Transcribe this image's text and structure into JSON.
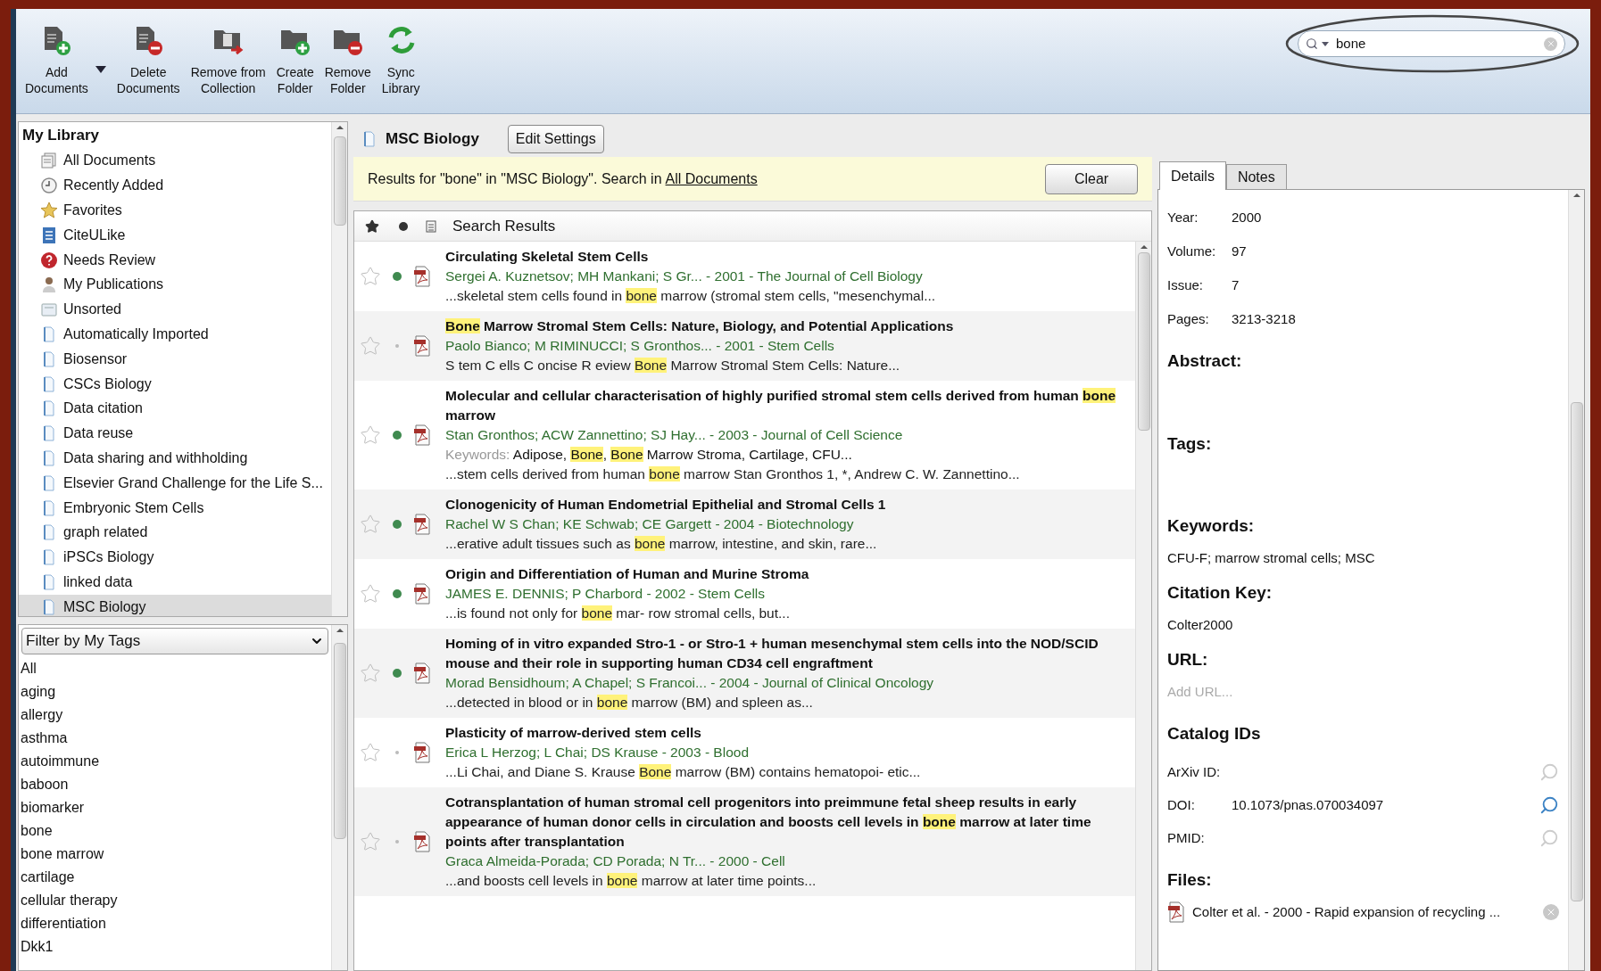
{
  "toolbar": {
    "buttons": [
      {
        "label": "Add Documents",
        "kind": "doc-add",
        "menu": true
      },
      {
        "label": "Delete Documents",
        "kind": "doc-delete",
        "menu": false
      },
      {
        "label": "Remove from Collection",
        "kind": "collection-remove",
        "menu": false
      },
      {
        "label": "Create Folder",
        "kind": "folder-add",
        "menu": false
      },
      {
        "label": "Remove Folder",
        "kind": "folder-delete",
        "menu": false
      },
      {
        "label": "Sync Library",
        "kind": "sync",
        "menu": false
      }
    ],
    "search": {
      "value": "bone",
      "circled": true
    }
  },
  "library": {
    "title": "My Library",
    "items": [
      {
        "label": "All Documents",
        "kind": "all",
        "selected": false
      },
      {
        "label": "Recently Added",
        "kind": "recent",
        "selected": false
      },
      {
        "label": "Favorites",
        "kind": "favorites",
        "selected": false
      },
      {
        "label": "CiteULike",
        "kind": "citeulike",
        "selected": false
      },
      {
        "label": "Needs Review",
        "kind": "review",
        "selected": false
      },
      {
        "label": "My Publications",
        "kind": "publications",
        "selected": false
      },
      {
        "label": "Unsorted",
        "kind": "unsorted",
        "selected": false
      },
      {
        "label": "Automatically Imported",
        "kind": "folder",
        "selected": false
      },
      {
        "label": "Biosensor",
        "kind": "folder",
        "selected": false
      },
      {
        "label": "CSCs Biology",
        "kind": "folder",
        "selected": false
      },
      {
        "label": "Data citation",
        "kind": "folder",
        "selected": false
      },
      {
        "label": "Data reuse",
        "kind": "folder",
        "selected": false
      },
      {
        "label": "Data sharing and withholding",
        "kind": "folder",
        "selected": false
      },
      {
        "label": "Elsevier Grand Challenge for the Life S...",
        "kind": "folder",
        "selected": false
      },
      {
        "label": "Embryonic Stem Cells",
        "kind": "folder",
        "selected": false
      },
      {
        "label": "graph related",
        "kind": "folder",
        "selected": false
      },
      {
        "label": "iPSCs Biology",
        "kind": "folder",
        "selected": false
      },
      {
        "label": "linked data",
        "kind": "folder",
        "selected": false
      },
      {
        "label": "MSC Biology",
        "kind": "folder",
        "selected": true
      }
    ]
  },
  "tag_filter": {
    "label": "Filter by My Tags",
    "tags": [
      "All",
      "aging",
      "allergy",
      "asthma",
      "autoimmune",
      "baboon",
      "biomarker",
      "bone",
      "bone marrow",
      "cartilage",
      "cellular therapy",
      "differentiation",
      "Dkk1"
    ]
  },
  "collection": {
    "title": "MSC Biology",
    "settings_button": "Edit Settings"
  },
  "search_bar": {
    "text": "Results for \"bone\" in \"MSC Biology\". Search in",
    "link": "All Documents",
    "clear_button": "Clear"
  },
  "results": {
    "heading": "Search Results",
    "rows": [
      {
        "unread": true,
        "favorite": false,
        "title": [
          {
            "text": "Circulating Skeletal Stem Cells",
            "highlight": false
          }
        ],
        "authors": "Sergei A. Kuznetsov; MH Mankani; S Gr... - 2001 - The Journal of Cell Biology",
        "snippet": [
          {
            "text": "...skeletal stem cells found in ",
            "highlight": false
          },
          {
            "text": "bone",
            "highlight": true
          },
          {
            "text": " marrow (stromal stem cells, \"mesenchymal...",
            "highlight": false
          }
        ]
      },
      {
        "unread": false,
        "favorite": false,
        "title": [
          {
            "text": "Bone",
            "highlight": true
          },
          {
            "text": " Marrow Stromal Stem Cells: Nature, Biology, and Potential Applications",
            "highlight": false
          }
        ],
        "authors": "Paolo Bianco; M RIMINUCCI; S Gronthos... - 2001 - Stem Cells",
        "snippet": [
          {
            "text": "S tem C ells C oncise R eview ",
            "highlight": false
          },
          {
            "text": "Bone",
            "highlight": true
          },
          {
            "text": " Marrow Stromal Stem Cells: Nature...",
            "highlight": false
          }
        ]
      },
      {
        "unread": true,
        "favorite": false,
        "title": [
          {
            "text": "Molecular and cellular characterisation of highly purified stromal stem cells derived from human ",
            "highlight": false
          },
          {
            "text": "bone",
            "highlight": true
          },
          {
            "text": " marrow",
            "highlight": false
          }
        ],
        "authors": "Stan Gronthos; ACW Zannettino; SJ Hay... - 2003 - Journal of Cell Science",
        "keywords": {
          "label": "Keywords:",
          "parts": [
            {
              "text": "Adipose, ",
              "highlight": false
            },
            {
              "text": "Bone",
              "highlight": true
            },
            {
              "text": ", ",
              "highlight": false
            },
            {
              "text": "Bone",
              "highlight": true
            },
            {
              "text": " Marrow Stroma, Cartilage, CFU...",
              "highlight": false
            }
          ]
        },
        "snippet": [
          {
            "text": "...stem cells derived from human ",
            "highlight": false
          },
          {
            "text": "bone",
            "highlight": true
          },
          {
            "text": " marrow Stan Gronthos 1, *, Andrew C. W. Zannettino...",
            "highlight": false
          }
        ]
      },
      {
        "unread": true,
        "favorite": false,
        "title": [
          {
            "text": "Clonogenicity of Human Endometrial Epithelial and Stromal Cells 1",
            "highlight": false
          }
        ],
        "authors": "Rachel W S Chan; KE Schwab; CE Gargett - 2004 - Biotechnology",
        "snippet": [
          {
            "text": "...erative adult tissues such as ",
            "highlight": false
          },
          {
            "text": "bone",
            "highlight": true
          },
          {
            "text": " marrow, intestine, and skin, rare...",
            "highlight": false
          }
        ]
      },
      {
        "unread": true,
        "favorite": false,
        "title": [
          {
            "text": "Origin and Differentiation of Human and Murine Stroma",
            "highlight": false
          }
        ],
        "authors": "JAMES E. DENNIS; P Charbord - 2002 - Stem Cells",
        "snippet": [
          {
            "text": "...is found not only for ",
            "highlight": false
          },
          {
            "text": "bone",
            "highlight": true
          },
          {
            "text": " mar- row stromal cells, but...",
            "highlight": false
          }
        ]
      },
      {
        "unread": true,
        "favorite": false,
        "title": [
          {
            "text": "Homing of in vitro expanded Stro-1 - or Stro-1 + human mesenchymal stem cells into the NOD/SCID mouse and their role in supporting human CD34 cell engraftment",
            "highlight": false
          }
        ],
        "authors": "Morad Bensidhoum; A Chapel; S Francoi... - 2004 - Journal of Clinical Oncology",
        "snippet": [
          {
            "text": "...detected in blood or in ",
            "highlight": false
          },
          {
            "text": "bone",
            "highlight": true
          },
          {
            "text": " marrow (BM) and spleen as...",
            "highlight": false
          }
        ]
      },
      {
        "unread": false,
        "favorite": false,
        "title": [
          {
            "text": "Plasticity of marrow-derived stem cells",
            "highlight": false
          }
        ],
        "authors": "Erica L Herzog; L Chai; DS Krause - 2003 - Blood",
        "snippet": [
          {
            "text": "...Li Chai, and Diane S. Krause ",
            "highlight": false
          },
          {
            "text": "Bone",
            "highlight": true
          },
          {
            "text": " marrow (BM) contains hematopoi- etic...",
            "highlight": false
          }
        ]
      },
      {
        "unread": false,
        "favorite": false,
        "title": [
          {
            "text": "Cotransplantation of human stromal cell progenitors into preimmune fetal sheep results in early appearance of human donor cells in circulation and boosts cell levels in ",
            "highlight": false
          },
          {
            "text": "bone",
            "highlight": true
          },
          {
            "text": " marrow at later time points after transplantation",
            "highlight": false
          }
        ],
        "authors": "Graca Almeida-Porada; CD Porada; N Tr... - 2000 - Cell",
        "snippet": [
          {
            "text": "...and boosts cell levels in ",
            "highlight": false
          },
          {
            "text": "bone",
            "highlight": true
          },
          {
            "text": " marrow at later time points...",
            "highlight": false
          }
        ]
      }
    ]
  },
  "details": {
    "tabs": [
      {
        "label": "Details",
        "selected": true
      },
      {
        "label": "Notes",
        "selected": false
      }
    ],
    "fields": [
      {
        "label": "Year:",
        "value": "2000"
      },
      {
        "label": "Volume:",
        "value": "97"
      },
      {
        "label": "Issue:",
        "value": "7"
      },
      {
        "label": "Pages:",
        "value": "3213-3218"
      }
    ],
    "sections": [
      {
        "kind": "empty",
        "heading": "Abstract:"
      },
      {
        "kind": "empty",
        "heading": "Tags:"
      },
      {
        "kind": "text",
        "heading": "Keywords:",
        "value": "CFU-F; marrow stromal cells; MSC"
      },
      {
        "kind": "text",
        "heading": "Citation Key:",
        "value": "Colter2000"
      },
      {
        "kind": "field",
        "heading": "URL:",
        "placeholder": "Add URL..."
      },
      {
        "kind": "ids",
        "heading": "Catalog IDs",
        "ids": [
          {
            "label": "ArXiv ID:",
            "active": false
          },
          {
            "label": "DOI:",
            "value": "10.1073/pnas.070034097",
            "active": true
          },
          {
            "label": "PMID:",
            "active": false
          }
        ]
      },
      {
        "kind": "files",
        "heading": "Files:",
        "files": [
          "Colter et al. - 2000 - Rapid expansion of recycling ..."
        ]
      }
    ]
  }
}
